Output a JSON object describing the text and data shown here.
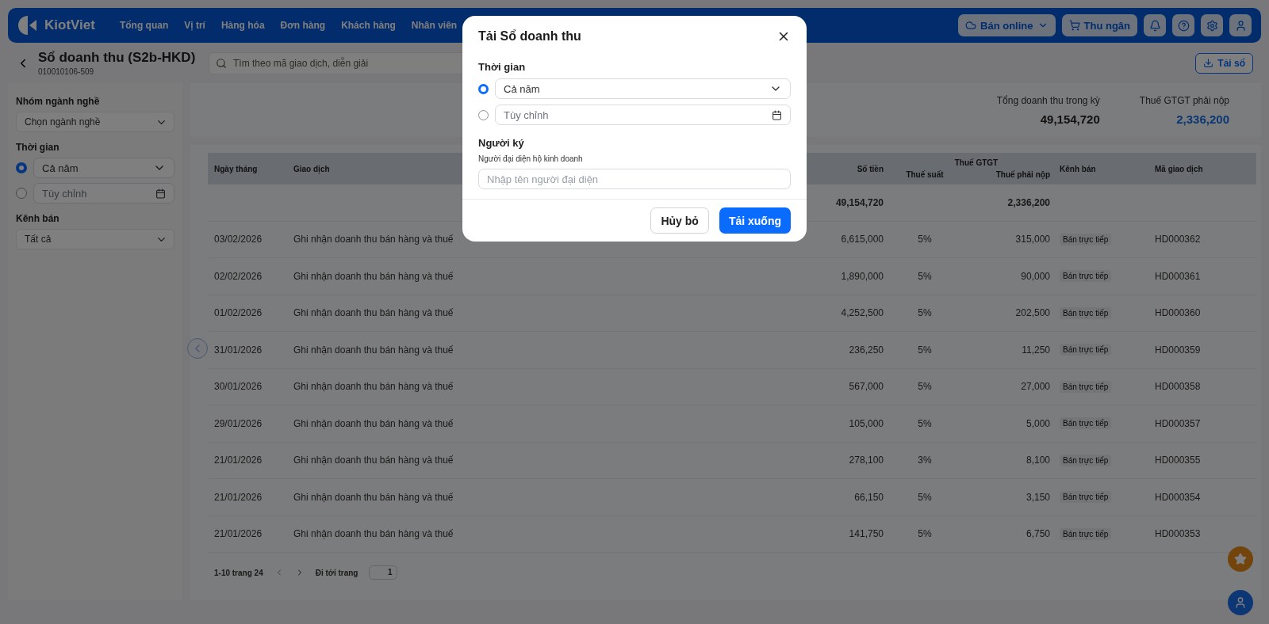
{
  "nav": {
    "brand": "KiotViet",
    "items": [
      "Tổng quan",
      "Vị trí",
      "Hàng hóa",
      "Đơn hàng",
      "Khách hàng",
      "Nhân viên"
    ],
    "online_button": "Bán online",
    "cashier_button": "Thu ngân"
  },
  "header": {
    "title": "Sổ doanh thu (S2b-HKD)",
    "subtitle": "010010106-509",
    "search_placeholder": "Tìm theo mã giao dịch, diễn giải",
    "download_button": "Tải sổ"
  },
  "filters": {
    "industry": {
      "label": "Nhóm ngành nghề",
      "value": "Chọn ngành nghề"
    },
    "time": {
      "label": "Thời gian",
      "options": [
        {
          "kind": "select",
          "text": "Cả năm",
          "selected": true
        },
        {
          "kind": "date",
          "placeholder": "Tùy chỉnh",
          "selected": false
        }
      ]
    },
    "channel": {
      "label": "Kênh bán",
      "value": "Tất cả"
    }
  },
  "summary": [
    {
      "label": "Tổng doanh thu trong kỳ",
      "value": "49,154,720",
      "highlight": false
    },
    {
      "label": "Thuế GTGT phải nộp",
      "value": "2,336,200",
      "highlight": true
    }
  ],
  "table": {
    "columns": {
      "date": "Ngày tháng",
      "desc": "Giao dịch",
      "amount": "Số tiền",
      "tax_group": "Thuế GTGT",
      "rate": "Thuế suất",
      "tax": "Thuế phải nộp",
      "channel": "Kênh bán",
      "code": "Mã giao dịch"
    },
    "totals": {
      "amount": "49,154,720",
      "tax": "2,336,200"
    },
    "rows": [
      {
        "date": "03/02/2026",
        "desc": "Ghi nhận doanh thu bán hàng và thuế",
        "amount": "6,615,000",
        "rate": "5%",
        "tax": "315,000",
        "channel": "Bán trực tiếp",
        "code": "HD000362"
      },
      {
        "date": "02/02/2026",
        "desc": "Ghi nhận doanh thu bán hàng và thuế",
        "amount": "1,890,000",
        "rate": "5%",
        "tax": "90,000",
        "channel": "Bán trực tiếp",
        "code": "HD000361"
      },
      {
        "date": "01/02/2026",
        "desc": "Ghi nhận doanh thu bán hàng và thuế",
        "amount": "4,252,500",
        "rate": "5%",
        "tax": "202,500",
        "channel": "Bán trực tiếp",
        "code": "HD000360"
      },
      {
        "date": "31/01/2026",
        "desc": "Ghi nhận doanh thu bán hàng và thuế",
        "amount": "236,250",
        "rate": "5%",
        "tax": "11,250",
        "channel": "Bán trực tiếp",
        "code": "HD000359"
      },
      {
        "date": "30/01/2026",
        "desc": "Ghi nhận doanh thu bán hàng và thuế",
        "amount": "567,000",
        "rate": "5%",
        "tax": "27,000",
        "channel": "Bán trực tiếp",
        "code": "HD000358"
      },
      {
        "date": "29/01/2026",
        "desc": "Ghi nhận doanh thu bán hàng và thuế",
        "amount": "105,000",
        "rate": "5%",
        "tax": "5,000",
        "channel": "Bán trực tiếp",
        "code": "HD000357"
      },
      {
        "date": "21/01/2026",
        "desc": "Ghi nhận doanh thu bán hàng và thuế",
        "amount": "278,100",
        "rate": "3%",
        "tax": "8,100",
        "channel": "Bán trực tiếp",
        "code": "HD000355"
      },
      {
        "date": "21/01/2026",
        "desc": "Ghi nhận doanh thu bán hàng và thuế",
        "amount": "66,150",
        "rate": "5%",
        "tax": "3,150",
        "channel": "Bán trực tiếp",
        "code": "HD000354"
      },
      {
        "date": "21/01/2026",
        "desc": "Ghi nhận doanh thu bán hàng và thuế",
        "amount": "141,750",
        "rate": "5%",
        "tax": "6,750",
        "channel": "Bán trực tiếp",
        "code": "HD000353"
      }
    ]
  },
  "pagination": {
    "range": "1-10 trang 24",
    "goto_label": "Đi tới trang",
    "page": "1"
  },
  "dialog": {
    "title": "Tải Sổ doanh thu",
    "time_label": "Thời gian",
    "time_options": [
      {
        "kind": "select",
        "text": "Cả năm",
        "selected": true
      },
      {
        "kind": "date",
        "placeholder": "Tùy chỉnh",
        "selected": false
      }
    ],
    "signer_label": "Người ký",
    "signer_sublabel": "Người đại diện hộ kinh doanh",
    "signer_placeholder": "Nhập tên người đại diện",
    "cancel_button": "Hủy bỏ",
    "confirm_button": "Tải xuống"
  }
}
